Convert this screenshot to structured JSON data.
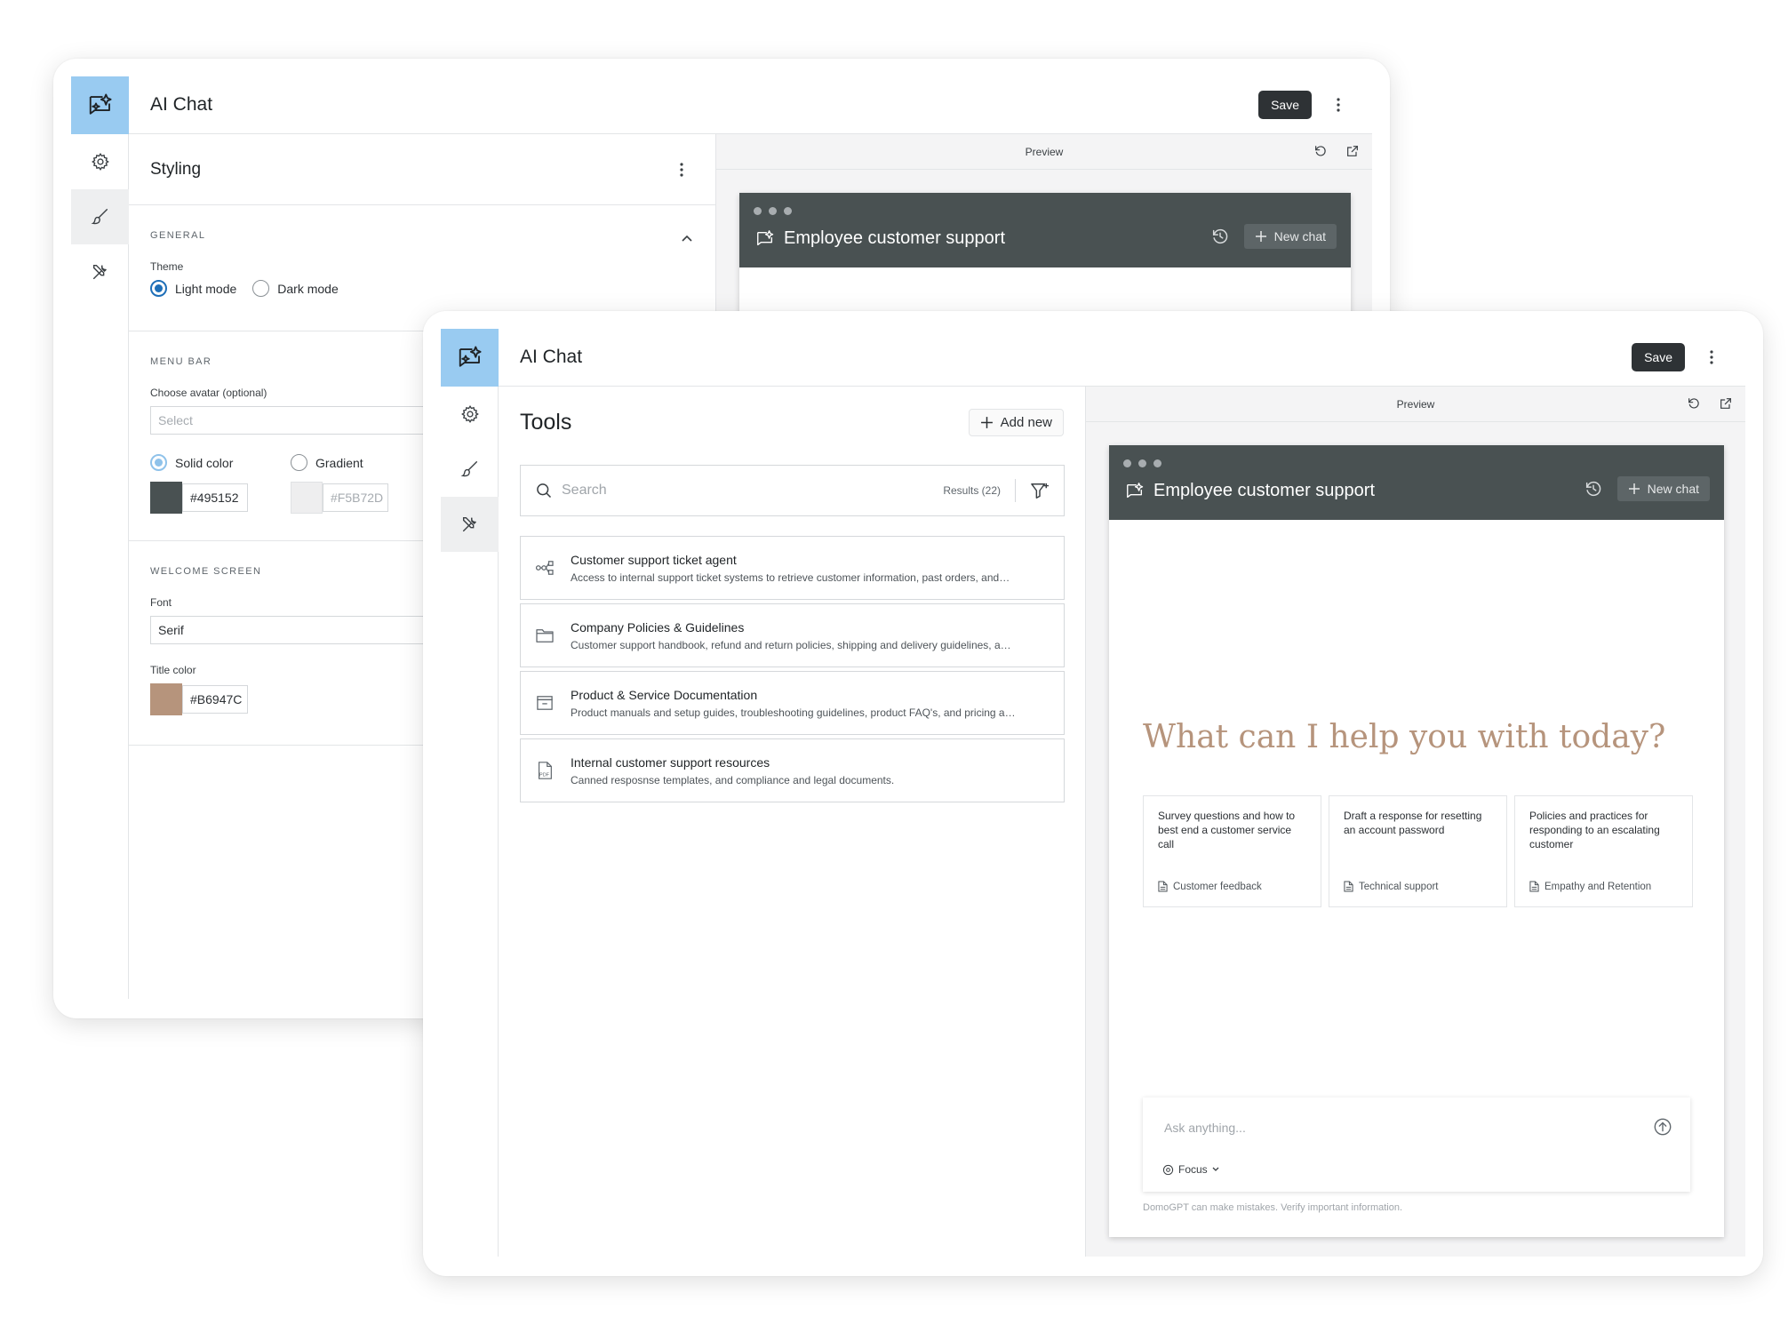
{
  "app": {
    "title": "AI Chat",
    "save_label": "Save"
  },
  "styling_window": {
    "panel_title": "Styling",
    "general": {
      "title": "GENERAL",
      "theme_label": "Theme",
      "theme_options": [
        "Light mode",
        "Dark mode"
      ],
      "theme_selected": "Light mode"
    },
    "menu_bar": {
      "title": "MENU BAR",
      "avatar_label": "Choose avatar (optional)",
      "avatar_placeholder": "Select",
      "color_options": [
        "Solid color",
        "Gradient"
      ],
      "solid_hex": "#495152",
      "gradient_hex": "#F5B72D"
    },
    "welcome_screen": {
      "title": "WELCOME SCREEN",
      "font_label": "Font",
      "font_value": "Serif",
      "title_color_label": "Title color",
      "title_color_hex": "#B6947C"
    }
  },
  "tools_window": {
    "panel_title": "Tools",
    "add_new_label": "Add new",
    "search_placeholder": "Search",
    "results_label": "Results (22)",
    "tools": [
      {
        "name": "Customer support ticket agent",
        "desc": "Access to internal support ticket systems to retrieve customer information, past orders, and…",
        "icon": "workflow-icon"
      },
      {
        "name": "Company Policies & Guidelines",
        "desc": "Customer support handbook, refund and return policies, shipping and delivery guidelines, a…",
        "icon": "folder-icon"
      },
      {
        "name": "Product & Service Documentation",
        "desc": "Product manuals and setup guides, troubleshooting guidelines, product FAQ's, and pricing a…",
        "icon": "archive-icon"
      },
      {
        "name": "Internal customer support resources",
        "desc": "Canned resposnse templates, and compliance and legal documents.",
        "icon": "pdf-icon"
      }
    ]
  },
  "preview": {
    "label": "Preview",
    "chat_title": "Employee customer support",
    "new_chat_label": "New chat",
    "welcome_title": "What can I help you with today?",
    "suggestions": [
      {
        "text": "Survey questions and how to best end a customer service call",
        "tag": "Customer feedback"
      },
      {
        "text": "Draft a response for resetting an account password",
        "tag": "Technical support"
      },
      {
        "text": "Policies and practices for responding to an escalating customer",
        "tag": "Empathy and Retention"
      }
    ],
    "ask_placeholder": "Ask anything...",
    "focus_label": "Focus",
    "disclaimer": "DomoGPT can make mistakes. Verify important information."
  },
  "colors": {
    "logo_bg": "#99CBF1",
    "chat_header": "#495152",
    "title_color": "#B6947C",
    "accent": "#1E6FB8"
  }
}
